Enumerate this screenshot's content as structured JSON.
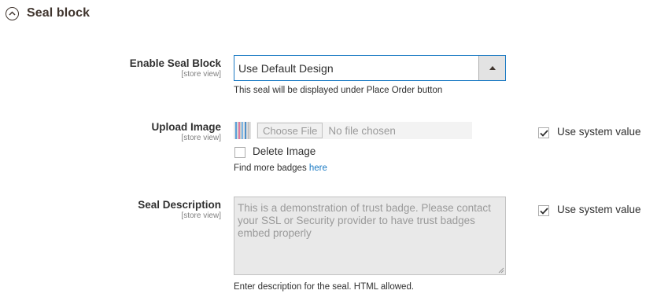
{
  "section": {
    "title": "Seal block",
    "icon": "chevron-up-circle-icon"
  },
  "rows": {
    "enable_seal_block": {
      "label": "Enable Seal Block",
      "scope": "[store view]",
      "selected_value": "Use Default Design",
      "note": "This seal will be displayed under Place Order button"
    },
    "upload_image": {
      "label": "Upload Image",
      "scope": "[store view]",
      "choose_file_label": "Choose File",
      "file_status": "No file chosen",
      "delete_image_label": "Delete Image",
      "find_more_text": "Find more badges ",
      "find_more_link": "here",
      "use_system_value_label": "Use system value",
      "use_system_value_checked": true
    },
    "seal_description": {
      "label": "Seal Description",
      "scope": "[store view]",
      "value": "This is a demonstration of trust badge. Please contact your SSL or Security provider to have trust badges embed properly",
      "note": "Enter description for the seal. HTML allowed.",
      "use_system_value_label": "Use system value",
      "use_system_value_checked": true
    }
  },
  "colors": {
    "accent": "#1979c3",
    "text": "#303030",
    "muted": "#808080",
    "title": "#41362f"
  }
}
